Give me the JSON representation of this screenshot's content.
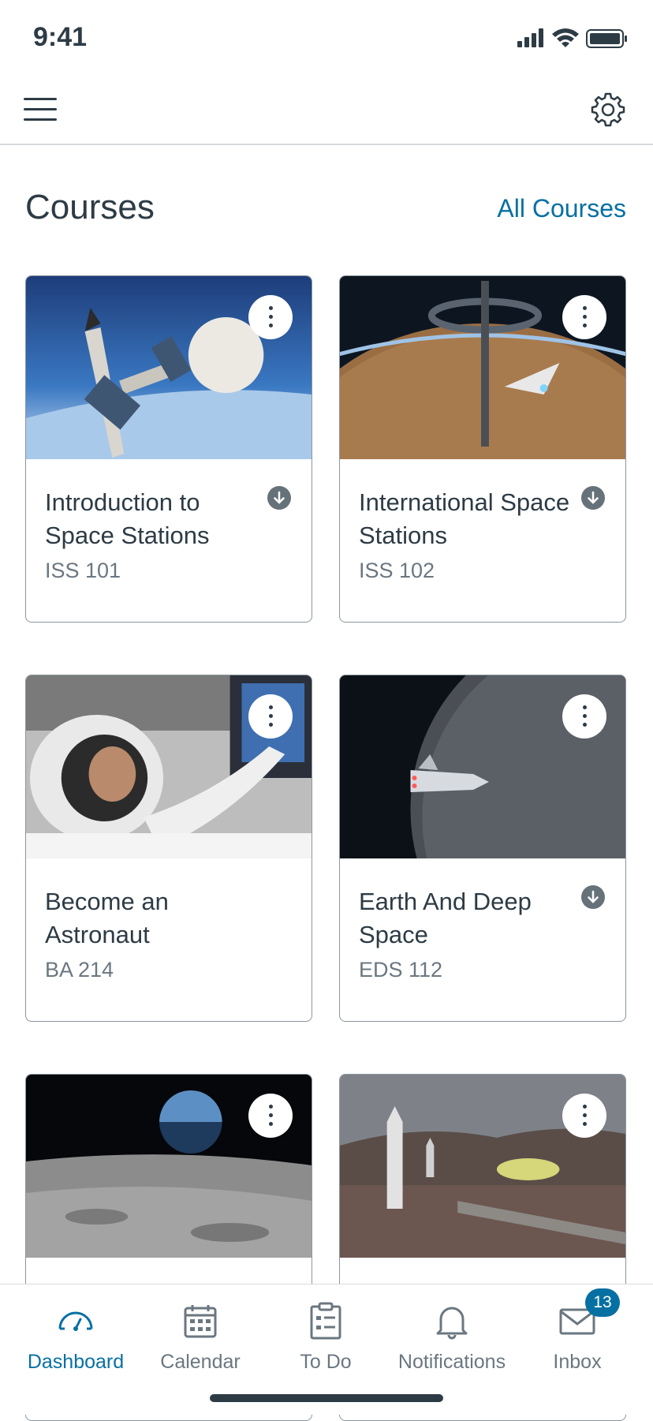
{
  "status_bar": {
    "time": "9:41"
  },
  "header": {
    "title": "Courses",
    "all_courses_link": "All Courses"
  },
  "courses": [
    {
      "title": "Introduction to Space Stations",
      "code": "ISS 101",
      "downloaded": true,
      "image_icon": "space-station-image"
    },
    {
      "title": "International Space Stations",
      "code": "ISS 102",
      "downloaded": true,
      "image_icon": "ring-station-image"
    },
    {
      "title": "Become an Astronaut",
      "code": "BA 214",
      "downloaded": false,
      "image_icon": "astronaut-image"
    },
    {
      "title": "Earth And Deep Space",
      "code": "EDS 112",
      "downloaded": true,
      "image_icon": "moon-spaceship-image"
    },
    {
      "title": "",
      "code": "",
      "downloaded": false,
      "image_icon": "lunar-surface-image"
    },
    {
      "title": "",
      "code": "",
      "downloaded": false,
      "image_icon": "mars-base-image"
    }
  ],
  "tab_bar": {
    "dashboard": "Dashboard",
    "calendar": "Calendar",
    "todo": "To Do",
    "notifications": "Notifications",
    "inbox": "Inbox",
    "inbox_badge": "13"
  },
  "colors": {
    "accent": "#0770a3",
    "text": "#2d3b45",
    "muted": "#6b7780",
    "border": "#8b969e"
  }
}
